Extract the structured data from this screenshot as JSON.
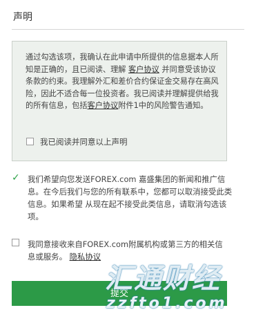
{
  "header": {
    "title": "声明"
  },
  "declaration": {
    "text_1": "通过勾选该项，我确认在此申请中所提供的信息据本人所知是正确的，且已阅读、理解 ",
    "link_1": "客户协议",
    "text_2": " 并同意受该协议条款的约束。我理解外汇和差价合约保证金交易存在高风险，因此不适合每一位投资者。我已阅读并理解提供给我的所有信息，包括",
    "link_2": "客户协议",
    "text_3": "附件1中的风险警告通知。",
    "checkbox_label": "我已阅读并同意以上声明",
    "checked": false
  },
  "option_marketing": {
    "checked": true,
    "text": "我们希望向您发送FOREX.com 嘉盛集团的新闻和推广信息。在今后我们与您的所有联系中，您都可以取消接受此类信息。如果希望 从现在起不接受此类信息，请取消勾选该项。"
  },
  "option_affiliates": {
    "checked": false,
    "text": "我同意接收来自FOREX.com附属机构或第三方的相关信息或服务。",
    "link": "隐私协议"
  },
  "submit": {
    "label": "提交"
  },
  "watermark": {
    "main": "汇通财经",
    "sub": "zzfto1.com"
  },
  "colors": {
    "accent": "#2c9a47",
    "box_bg": "#edf1ed"
  }
}
